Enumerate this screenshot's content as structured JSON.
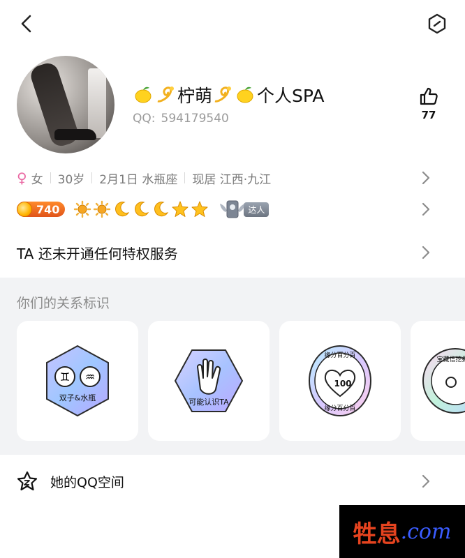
{
  "profile": {
    "name": "柠萌",
    "name_suffix": "个人SPA",
    "qq_label": "QQ:",
    "qq_number": "594179540",
    "like_count": "77"
  },
  "info": {
    "gender": "女",
    "age": "30岁",
    "birthday": "2月1日 水瓶座",
    "location": "现居 江西·九江"
  },
  "level": {
    "value": "740",
    "expert_label": "达人"
  },
  "privilege_text": "TA 还未开通任何特权服务",
  "relationship": {
    "title": "你们的关系标识",
    "cards": [
      {
        "label": "双子&水瓶"
      },
      {
        "label": "可能认识TA"
      },
      {
        "top_text": "缘分百分百",
        "badge": "100",
        "bottom_text": "缘分百分百"
      },
      {
        "label": "宝藏信挖掘"
      }
    ]
  },
  "qzone": {
    "label": "她的QQ空间"
  },
  "watermark": {
    "left": "牲",
    "mid": "息",
    "right": ".com"
  },
  "icons": {
    "back": "chevron-left-icon",
    "settings": "hexagon-settings-icon",
    "like": "thumbs-up-icon",
    "female": "female-icon",
    "chevron": "chevron-right-icon",
    "qzone": "star-outline-icon"
  },
  "colors": {
    "accent_pink": "#ea6aa4",
    "level_orange": "#e0541a",
    "section_bg": "#f2f3f5"
  }
}
